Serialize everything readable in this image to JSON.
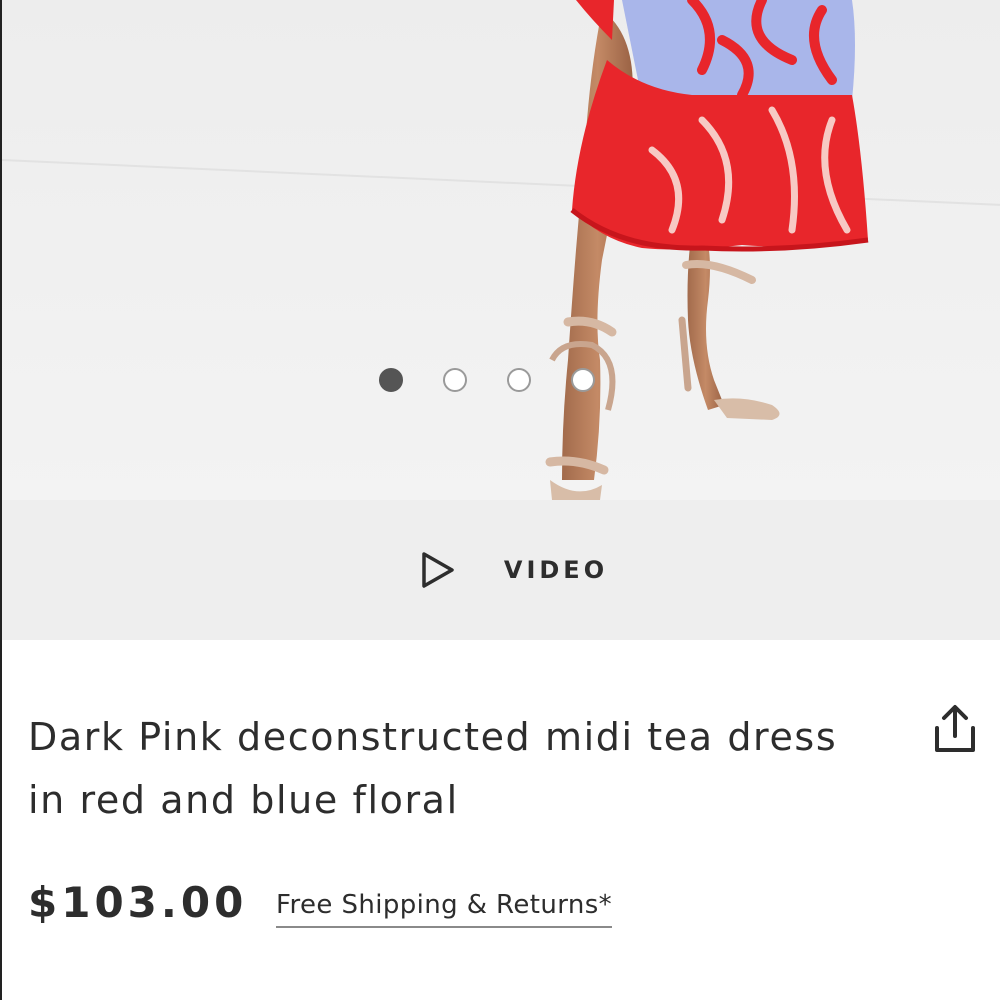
{
  "gallery": {
    "image_alt": "Model wearing red and blue floral midi dress with nude strappy heels",
    "slides": 4,
    "active_slide": 1
  },
  "video": {
    "label": "VIDEO",
    "icon": "play-icon"
  },
  "product": {
    "title": "Dark Pink deconstructed midi tea dress in red and blue floral",
    "price": "$103.00",
    "shipping_link": "Free Shipping & Returns*",
    "share_icon": "share-icon"
  },
  "colors": {
    "text": "#2d2d2d",
    "band": "#eeeeee",
    "dress_red": "#e8262b",
    "dress_blue": "#a9b6ea"
  }
}
